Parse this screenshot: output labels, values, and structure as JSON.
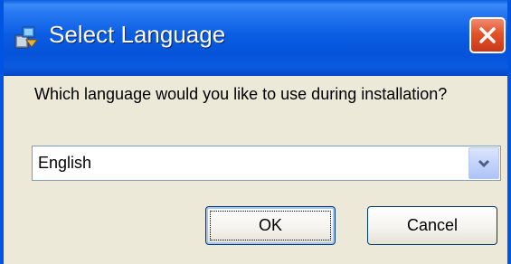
{
  "window": {
    "title": "Select Language",
    "icon": "installer-icon",
    "close_icon": "close-icon"
  },
  "dialog": {
    "prompt": "Which language would you like to use during installation?",
    "language_select": {
      "selected": "English",
      "arrow_icon": "chevron-down-icon"
    },
    "ok_label": "OK",
    "cancel_label": "Cancel"
  },
  "colors": {
    "titlebar": "#0553d8",
    "close_button": "#e2532a",
    "window_bg": "#ece9d8",
    "select_border": "#7f9db9"
  }
}
